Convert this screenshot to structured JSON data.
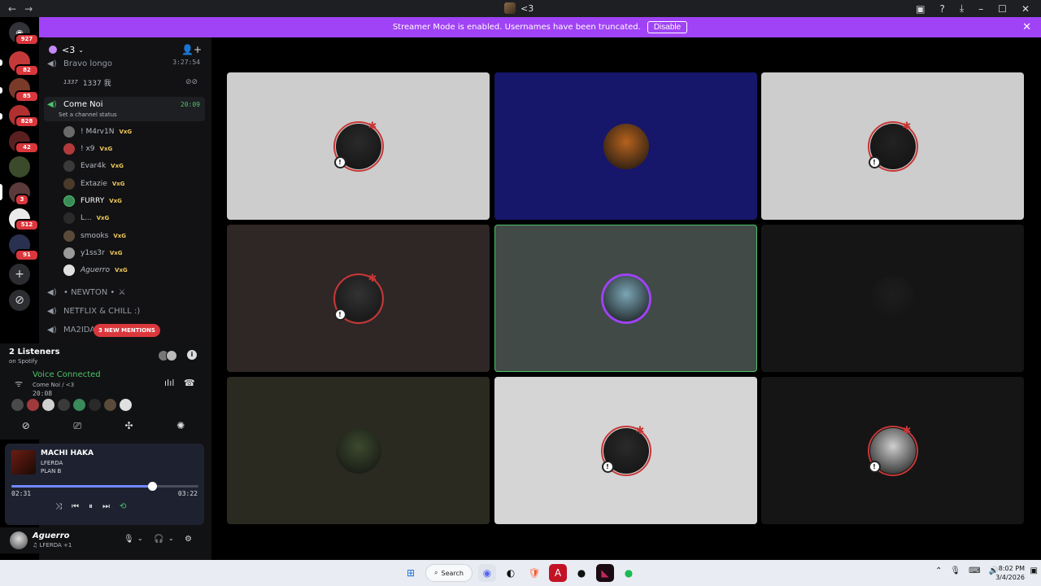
{
  "window": {
    "title": "<3"
  },
  "banner": {
    "message": "Streamer Mode is enabled. Usernames have been truncated.",
    "disable_label": "Disable"
  },
  "server_rail": {
    "badges": [
      "927",
      "82",
      "85",
      "828",
      "42",
      "3",
      "512",
      "91"
    ]
  },
  "guild": {
    "name": "<3"
  },
  "channels": {
    "top_channel": {
      "name": "Bravo longo",
      "time": "3:27:54",
      "user": "1337 我"
    },
    "active_channel": {
      "name": "Come Noi",
      "time": "20:09",
      "status": "Set a channel status"
    },
    "members": [
      {
        "name": "! M4rv1N",
        "tag": "VxG"
      },
      {
        "name": "! x9",
        "tag": "VxG"
      },
      {
        "name": "Evar4k",
        "tag": "VxG"
      },
      {
        "name": "Extazie",
        "tag": "VxG"
      },
      {
        "name": "FURRY",
        "tag": "VxG"
      },
      {
        "name": "L...",
        "tag": "VxG"
      },
      {
        "name": "smooks",
        "tag": "VxG"
      },
      {
        "name": "y1ss3r",
        "tag": "VxG"
      },
      {
        "name": "Aguerro",
        "tag": "VxG"
      }
    ],
    "other_channels": [
      "• NEWTON •",
      "NETFLIX & CHILL :)",
      "MA2IDA"
    ],
    "mentions_label": "3 NEW MENTIONS"
  },
  "listeners": {
    "title": "2 Listeners",
    "subtitle": "on Spotify"
  },
  "voice": {
    "status": "Voice Connected",
    "channel": "Come Noi / <3",
    "timer": "20:08"
  },
  "player": {
    "track": "MACHI HAKA",
    "artist": "LFERDA",
    "album": "PLAN B",
    "elapsed": "02:31",
    "duration": "03:22",
    "progress": 0.75
  },
  "user": {
    "name": "Aguerro",
    "activity": "♫ LFERDA +1"
  },
  "taskbar": {
    "search_label": "Search",
    "time": "8:02 PM",
    "date": "3/4/2026"
  },
  "tiles": [
    {
      "bg": "#cdcdcd",
      "avatar": "#2a2a2a",
      "ring": true
    },
    {
      "bg": "#16166b",
      "avatar": "#b5621d",
      "ring": false
    },
    {
      "bg": "#cdcdcd",
      "avatar": "#222222",
      "ring": true
    },
    {
      "bg": "#2f2626",
      "avatar": "#333333",
      "ring": true
    },
    {
      "bg": "#414a47",
      "avatar": "#7aa5b5",
      "ring": false,
      "speaking": true
    },
    {
      "bg": "#151515",
      "avatar": "#1e1e1e",
      "ring": false
    },
    {
      "bg": "#2a2a20",
      "avatar": "#3c4a2e",
      "ring": false
    },
    {
      "bg": "#d5d5d5",
      "avatar": "#2a2a2a",
      "ring": true
    },
    {
      "bg": "#151515",
      "avatar": "#cfcfcf",
      "ring": true
    }
  ],
  "colors": {
    "accent": "#a042f5",
    "online": "#4ec26a",
    "danger": "#da373c",
    "sidebar": "#121214"
  }
}
